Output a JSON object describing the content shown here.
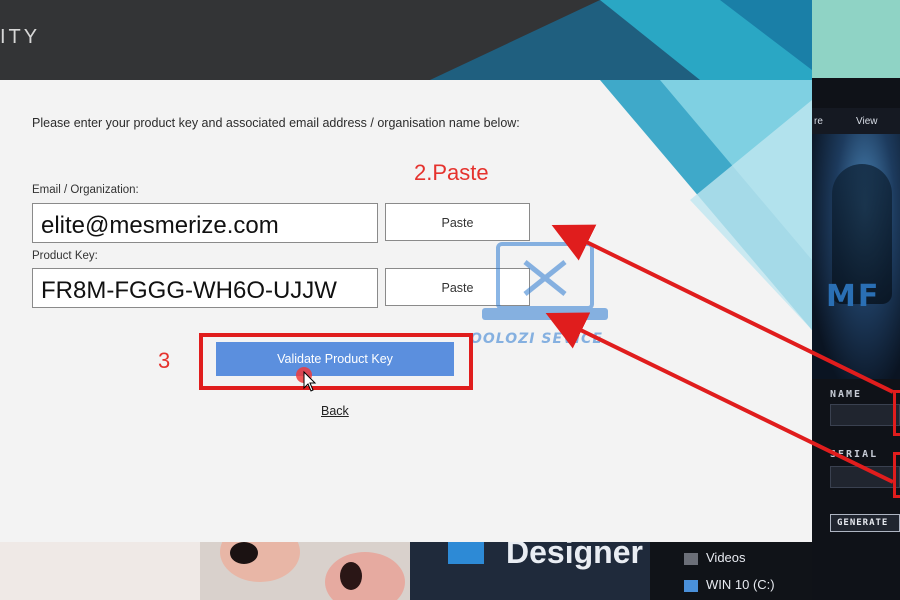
{
  "installer": {
    "title_fragment": "ITY",
    "instruction": "Please enter your product key and associated email address / organisation name below:",
    "email_label": "Email / Organization:",
    "email_value": "elite@mesmerize.com",
    "key_label": "Product Key:",
    "key_value": "FR8M-FGGG-WH6O-UJJW",
    "paste_label": "Paste",
    "validate_label": "Validate Product Key",
    "back_label": "Back"
  },
  "annotations": {
    "step2": "2.Paste",
    "step3": "3",
    "color": "#e5322d"
  },
  "watermark": {
    "text": "OOLOZI SEVICE",
    "icon": "tools-laptop-icon"
  },
  "keygen": {
    "tabs": [
      "re",
      "View"
    ],
    "name_label": "NAME",
    "serial_label": "SERIAL",
    "generate_label": "GENERATE"
  },
  "taskbar": {
    "designer_label": "Designer",
    "explorer_items": [
      "Videos",
      "WIN 10 (C:)"
    ]
  },
  "colors": {
    "header_bg": "#333436",
    "accent_blue": "#5b8fde",
    "highlight_red": "#e01d1d"
  }
}
